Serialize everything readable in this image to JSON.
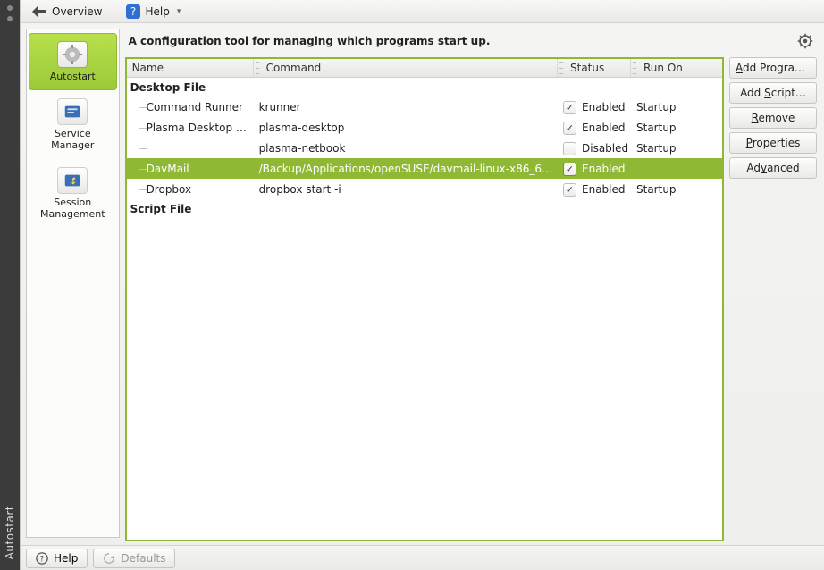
{
  "rail": {
    "title": "Autostart"
  },
  "topbar": {
    "overview": "Overview",
    "help": "Help"
  },
  "sidebar": {
    "items": [
      {
        "label": "Autostart"
      },
      {
        "label": "Service Manager"
      },
      {
        "label": "Session Management"
      }
    ]
  },
  "heading": "A configuration tool for managing which programs start up.",
  "table": {
    "columns": {
      "name": "Name",
      "command": "Command",
      "status": "Status",
      "runon": "Run On"
    },
    "sections": [
      {
        "title": "Desktop File",
        "rows": [
          {
            "name": "Command Runner",
            "command": "krunner",
            "checked": true,
            "status": "Enabled",
            "runon": "Startup",
            "selected": false
          },
          {
            "name": "Plasma Desktop W…",
            "command": "plasma-desktop",
            "checked": true,
            "status": "Enabled",
            "runon": "Startup",
            "selected": false
          },
          {
            "name": "",
            "command": "plasma-netbook",
            "checked": false,
            "status": "Disabled",
            "runon": "Startup",
            "selected": false
          },
          {
            "name": "DavMail",
            "command": "/Backup/Applications/openSUSE/davmail-linux-x86_6…",
            "checked": true,
            "status": "Enabled",
            "runon": "",
            "selected": true
          },
          {
            "name": "Dropbox",
            "command": "dropbox start -i",
            "checked": true,
            "status": "Enabled",
            "runon": "Startup",
            "selected": false
          }
        ]
      },
      {
        "title": "Script File",
        "rows": []
      }
    ]
  },
  "buttons": {
    "add_program": "Add Program…",
    "add_script": "Add Script…",
    "remove": "Remove",
    "properties": "Properties",
    "advanced": "Advanced"
  },
  "bottom": {
    "help": "Help",
    "defaults": "Defaults"
  }
}
